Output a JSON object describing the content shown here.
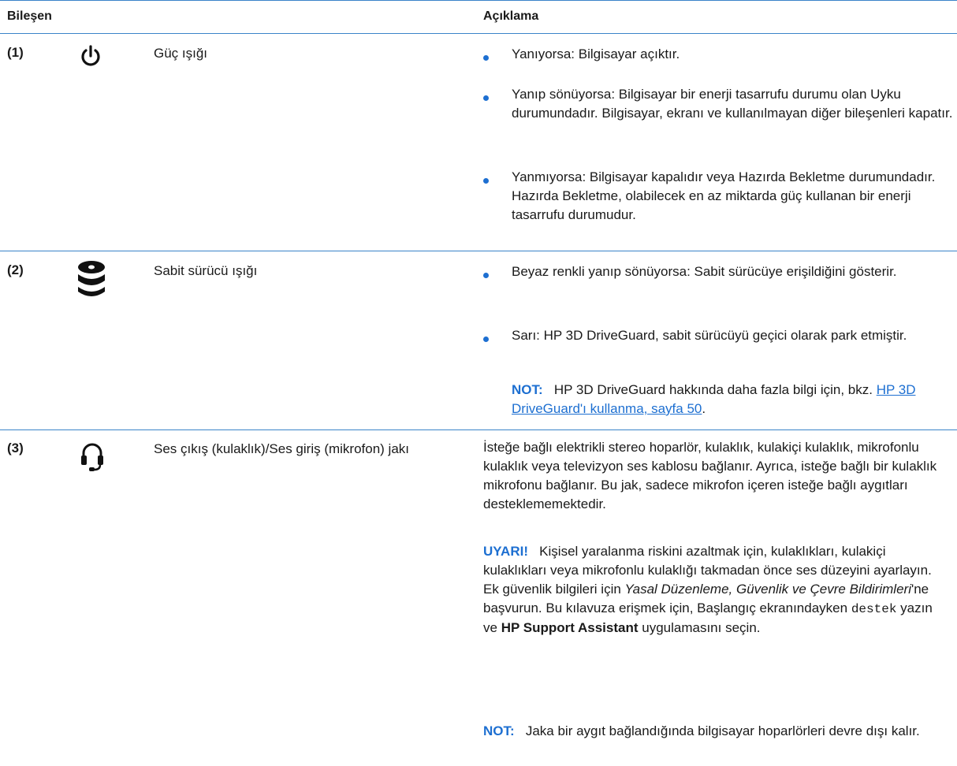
{
  "header": {
    "component_label": "Bileşen",
    "description_label": "Açıklama"
  },
  "rows": [
    {
      "number": "(1)",
      "icon": "power-icon",
      "name": "Güç ışığı",
      "bullets": [
        "Yanıyorsa: Bilgisayar açıktır.",
        "Yanıp sönüyorsa: Bilgisayar bir enerji tasarrufu durumu olan Uyku durumundadır. Bilgisayar, ekranı ve kullanılmayan diğer bileşenleri kapatır.",
        "Yanmıyorsa: Bilgisayar kapalıdır veya Hazırda Bekletme durumundadır. Hazırda Bekletme, olabilecek en az miktarda güç kullanan bir enerji tasarrufu durumudur."
      ]
    },
    {
      "number": "(2)",
      "icon": "hard-drive-icon",
      "name": "Sabit sürücü ışığı",
      "bullets": [
        "Beyaz renkli yanıp sönüyorsa: Sabit sürücüye erişildiğini gösterir.",
        "Sarı: HP 3D DriveGuard, sabit sürücüyü geçici olarak park etmiştir."
      ],
      "note": {
        "label": "NOT:",
        "text_before": "HP 3D DriveGuard hakkında daha fazla bilgi için, bkz.",
        "link": "HP 3D DriveGuard'ı kullanma, sayfa 50",
        "text_after": "."
      }
    },
    {
      "number": "(3)",
      "icon": "headset-icon",
      "name": "Ses çıkış (kulaklık)/Ses giriş (mikrofon) jakı",
      "description": "İsteğe bağlı elektrikli stereo hoparlör, kulaklık, kulakiçi kulaklık, mikrofonlu kulaklık veya televizyon ses kablosu bağlanır. Ayrıca, isteğe bağlı bir kulaklık mikrofonu bağlanır. Bu jak, sadece mikrofon içeren isteğe bağlı aygıtları desteklememektedir.",
      "warning": {
        "label": "UYARI!",
        "text1": "Kişisel yaralanma riskini azaltmak için, kulaklıkları, kulakiçi kulaklıkları veya mikrofonlu kulaklığı takmadan önce ses düzeyini ayarlayın. Ek güvenlik bilgileri için",
        "italic": "Yasal Düzenleme, Güvenlik ve Çevre Bildirimleri",
        "text2": "'ne başvurun. Bu kılavuza erişmek için, Başlangıç ekranındayken",
        "mono": "destek",
        "text3": "yazın ve",
        "bold": "HP Support Assistant",
        "text4": "uygulamasını seçin."
      },
      "note": {
        "label": "NOT:",
        "text": "Jaka bir aygıt bağlandığında bilgisayar hoparlörleri devre dışı kalır."
      }
    }
  ]
}
